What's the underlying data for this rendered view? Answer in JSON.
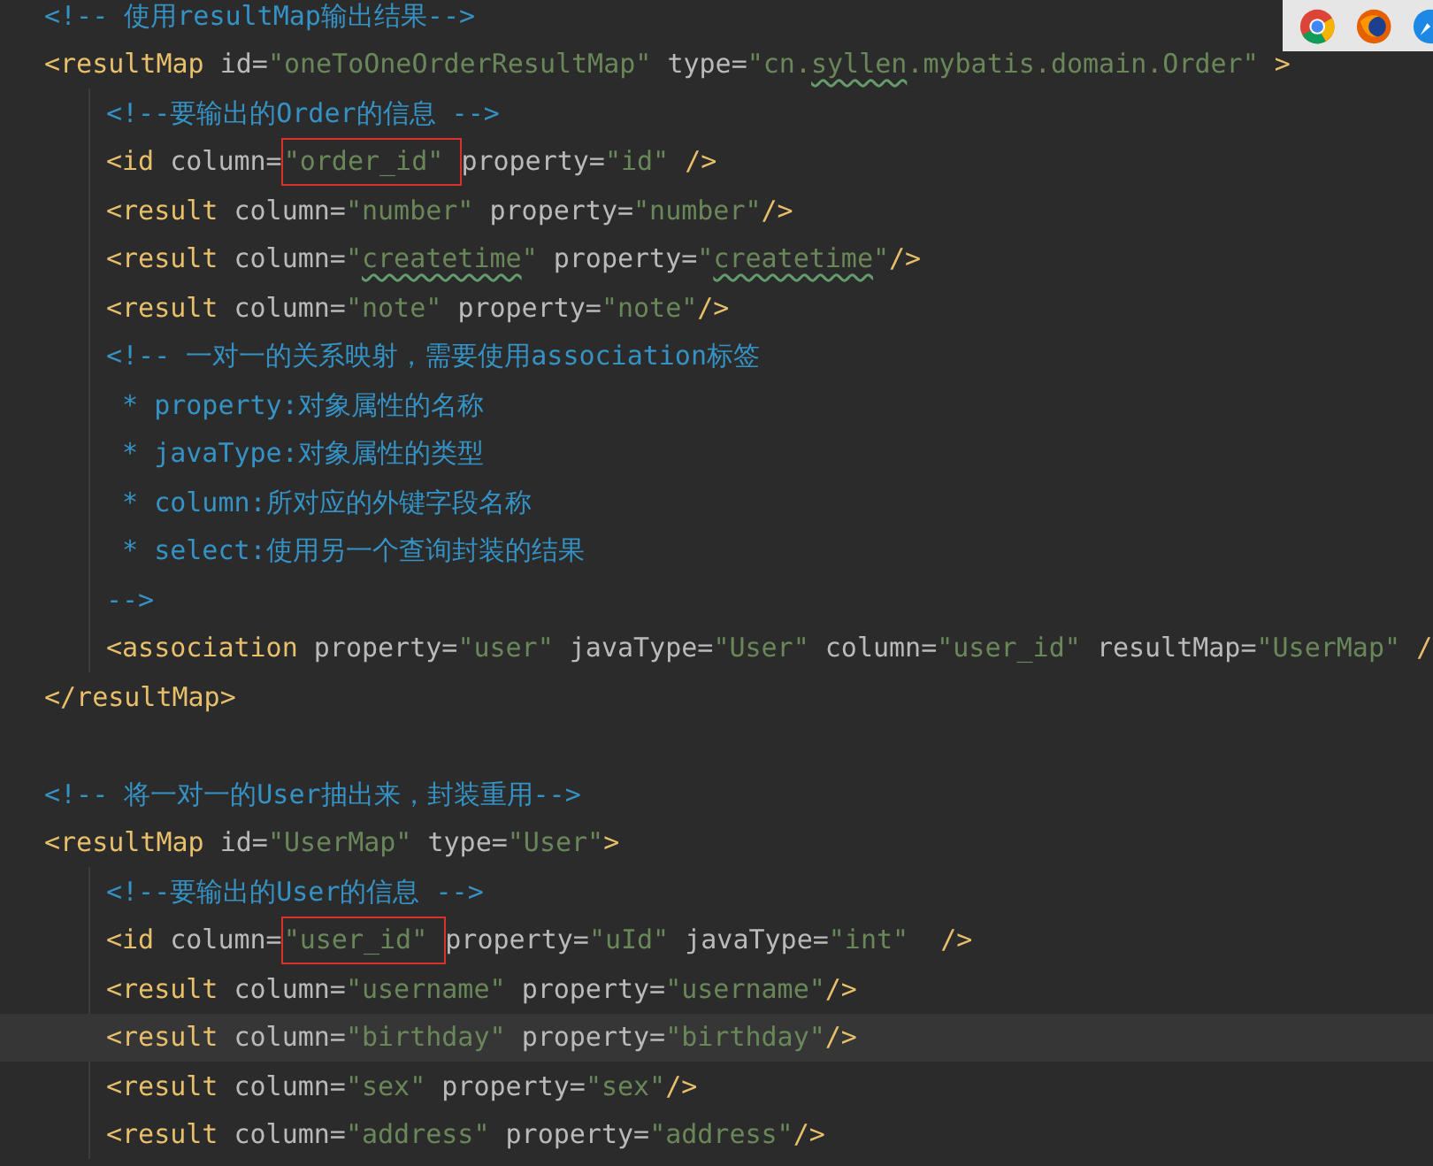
{
  "browser_icons": [
    {
      "kind": "chrome"
    },
    {
      "kind": "firefox"
    },
    {
      "kind": "safari"
    }
  ],
  "lines": [
    {
      "current": false,
      "segments": [
        {
          "kind": "comment",
          "text": "<!-- 使用resultMap输出结果-->"
        }
      ]
    },
    {
      "current": false,
      "segments": [
        {
          "kind": "tag",
          "text": "<resultMap "
        },
        {
          "kind": "attr",
          "text": "id="
        },
        {
          "kind": "value",
          "text": "\"oneToOneOrderResultMap\" "
        },
        {
          "kind": "attr",
          "text": "type="
        },
        {
          "kind": "value",
          "text": "\"cn."
        },
        {
          "kind": "value",
          "text": "syllen",
          "misspelled": true
        },
        {
          "kind": "value",
          "text": ".mybatis.domain.Order\" "
        },
        {
          "kind": "tag",
          "text": ">"
        }
      ],
      "children": [
        {
          "current": false,
          "segments": [
            {
              "kind": "comment",
              "text": "<!--要输出的Order的信息 -->"
            }
          ]
        },
        {
          "current": false,
          "segments": [
            {
              "kind": "tag",
              "text": "<id "
            },
            {
              "kind": "attr",
              "text": "column="
            },
            {
              "kind": "value",
              "text": "\"order_id\" ",
              "boxed": true
            },
            {
              "kind": "attr",
              "text": "property="
            },
            {
              "kind": "value",
              "text": "\"id\" "
            },
            {
              "kind": "tag",
              "text": "/>"
            }
          ]
        },
        {
          "current": false,
          "segments": [
            {
              "kind": "tag",
              "text": "<result "
            },
            {
              "kind": "attr",
              "text": "column="
            },
            {
              "kind": "value",
              "text": "\"number\" "
            },
            {
              "kind": "attr",
              "text": "property="
            },
            {
              "kind": "value",
              "text": "\"number\""
            },
            {
              "kind": "tag",
              "text": "/>"
            }
          ]
        },
        {
          "current": false,
          "segments": [
            {
              "kind": "tag",
              "text": "<result "
            },
            {
              "kind": "attr",
              "text": "column="
            },
            {
              "kind": "value",
              "text": "\""
            },
            {
              "kind": "value",
              "text": "createtime",
              "misspelled": true
            },
            {
              "kind": "value",
              "text": "\" "
            },
            {
              "kind": "attr",
              "text": "property="
            },
            {
              "kind": "value",
              "text": "\""
            },
            {
              "kind": "value",
              "text": "createtime",
              "misspelled": true
            },
            {
              "kind": "value",
              "text": "\""
            },
            {
              "kind": "tag",
              "text": "/>"
            }
          ]
        },
        {
          "current": false,
          "segments": [
            {
              "kind": "tag",
              "text": "<result "
            },
            {
              "kind": "attr",
              "text": "column="
            },
            {
              "kind": "value",
              "text": "\"note\" "
            },
            {
              "kind": "attr",
              "text": "property="
            },
            {
              "kind": "value",
              "text": "\"note\""
            },
            {
              "kind": "tag",
              "text": "/>"
            }
          ]
        },
        {
          "current": false,
          "segments": [
            {
              "kind": "comment",
              "text": "<!-- 一对一的关系映射，需要使用association标签"
            }
          ]
        },
        {
          "current": false,
          "segments": [
            {
              "kind": "comment",
              "text": " * property:对象属性的名称"
            }
          ]
        },
        {
          "current": false,
          "segments": [
            {
              "kind": "comment",
              "text": " * javaType:对象属性的类型"
            }
          ]
        },
        {
          "current": false,
          "segments": [
            {
              "kind": "comment",
              "text": " * column:所对应的外键字段名称"
            }
          ]
        },
        {
          "current": false,
          "segments": [
            {
              "kind": "comment",
              "text": " * select:使用另一个查询封装的结果"
            }
          ]
        },
        {
          "current": false,
          "segments": [
            {
              "kind": "comment",
              "text": "-->"
            }
          ]
        },
        {
          "current": false,
          "segments": [
            {
              "kind": "tag",
              "text": "<association "
            },
            {
              "kind": "attr",
              "text": "property="
            },
            {
              "kind": "value",
              "text": "\"user\" "
            },
            {
              "kind": "attr",
              "text": "javaType="
            },
            {
              "kind": "value",
              "text": "\"User\" "
            },
            {
              "kind": "attr",
              "text": "column="
            },
            {
              "kind": "value",
              "text": "\"user_id\" "
            },
            {
              "kind": "attr",
              "text": "resultMap="
            },
            {
              "kind": "value",
              "text": "\"UserMap\" "
            },
            {
              "kind": "tag",
              "text": "/"
            }
          ]
        }
      ]
    },
    {
      "current": false,
      "segments": [
        {
          "kind": "tag",
          "text": "</resultMap>"
        }
      ]
    },
    {
      "current": false
    },
    {
      "current": false,
      "segments": [
        {
          "kind": "comment",
          "text": "<!-- 将一对一的User抽出来，封装重用-->"
        }
      ]
    },
    {
      "current": false,
      "segments": [
        {
          "kind": "tag",
          "text": "<resultMap "
        },
        {
          "kind": "attr",
          "text": "id="
        },
        {
          "kind": "value",
          "text": "\"UserMap\" "
        },
        {
          "kind": "attr",
          "text": "type="
        },
        {
          "kind": "value",
          "text": "\"User\""
        },
        {
          "kind": "tag",
          "text": ">"
        }
      ],
      "children": [
        {
          "current": false,
          "segments": [
            {
              "kind": "comment",
              "text": "<!--要输出的User的信息 -->"
            }
          ]
        },
        {
          "current": false,
          "segments": [
            {
              "kind": "tag",
              "text": "<id "
            },
            {
              "kind": "attr",
              "text": "column="
            },
            {
              "kind": "value",
              "text": "\"user_id\" ",
              "boxed": true
            },
            {
              "kind": "attr",
              "text": "property="
            },
            {
              "kind": "value",
              "text": "\"uId\" "
            },
            {
              "kind": "attr",
              "text": "javaType="
            },
            {
              "kind": "value",
              "text": "\"int\"  "
            },
            {
              "kind": "tag",
              "text": "/>"
            }
          ]
        },
        {
          "current": false,
          "segments": [
            {
              "kind": "tag",
              "text": "<result "
            },
            {
              "kind": "attr",
              "text": "column="
            },
            {
              "kind": "value",
              "text": "\"username\" "
            },
            {
              "kind": "attr",
              "text": "property="
            },
            {
              "kind": "value",
              "text": "\"username\""
            },
            {
              "kind": "tag",
              "text": "/>"
            }
          ]
        },
        {
          "current": true,
          "segments": [
            {
              "kind": "tag",
              "text": "<result "
            },
            {
              "kind": "attr",
              "text": "column="
            },
            {
              "kind": "value",
              "text": "\"birthday\" "
            },
            {
              "kind": "attr",
              "text": "property="
            },
            {
              "kind": "value",
              "text": "\"birthday\""
            },
            {
              "kind": "tag",
              "text": "/>"
            }
          ]
        },
        {
          "current": false,
          "segments": [
            {
              "kind": "tag",
              "text": "<result "
            },
            {
              "kind": "attr",
              "text": "column="
            },
            {
              "kind": "value",
              "text": "\"sex\" "
            },
            {
              "kind": "attr",
              "text": "property="
            },
            {
              "kind": "value",
              "text": "\"sex\""
            },
            {
              "kind": "tag",
              "text": "/>"
            }
          ]
        },
        {
          "current": false,
          "segments": [
            {
              "kind": "tag",
              "text": "<result "
            },
            {
              "kind": "attr",
              "text": "column="
            },
            {
              "kind": "value",
              "text": "\"address\" "
            },
            {
              "kind": "attr",
              "text": "property="
            },
            {
              "kind": "value",
              "text": "\"address\""
            },
            {
              "kind": "tag",
              "text": "/>"
            }
          ]
        }
      ]
    }
  ]
}
